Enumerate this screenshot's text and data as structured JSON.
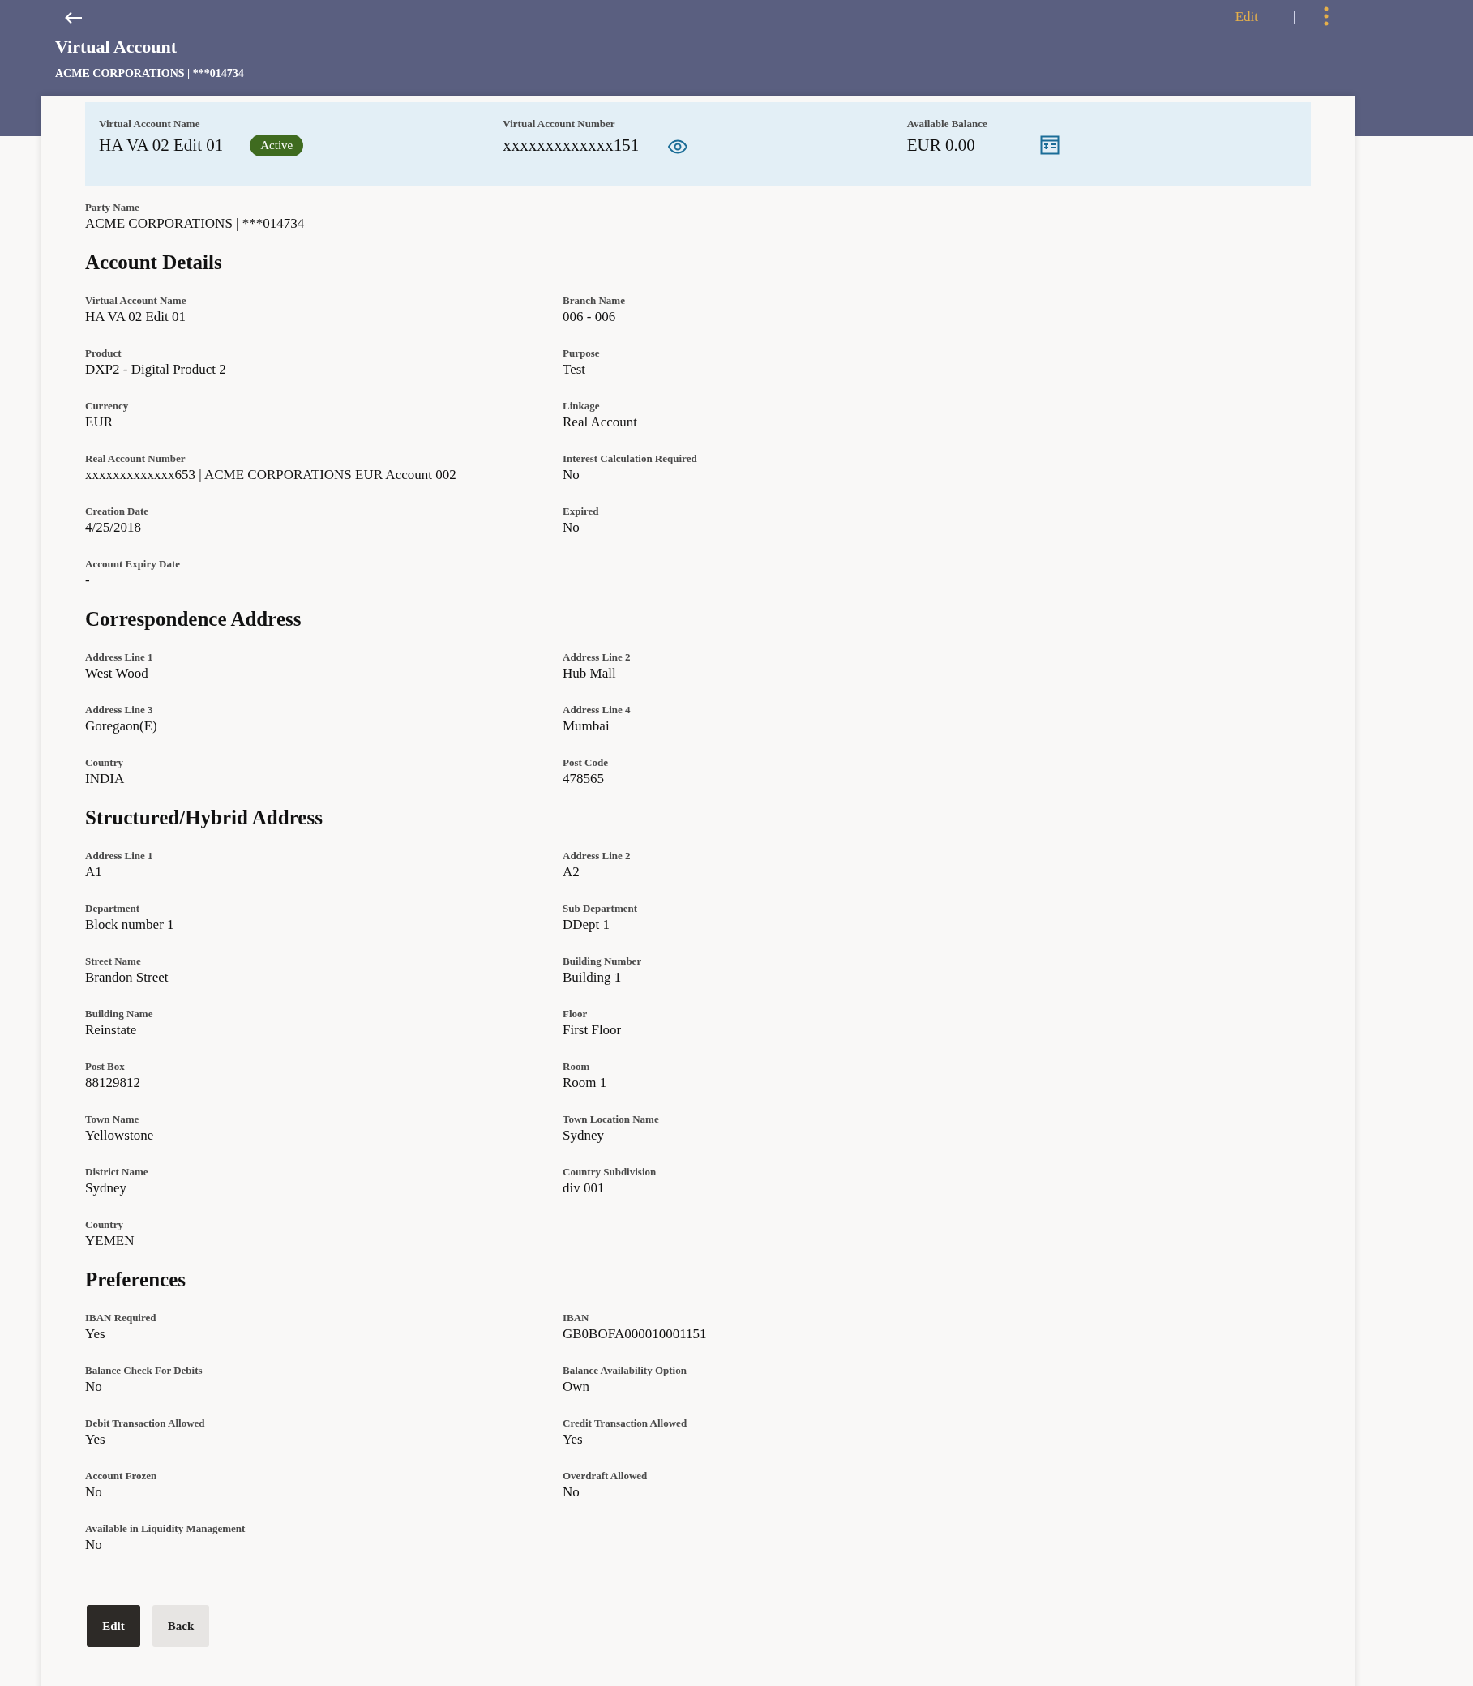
{
  "header": {
    "title": "Virtual Account",
    "subtitle": "ACME CORPORATIONS | ***014734",
    "edit_link": "Edit"
  },
  "summary": [
    {
      "label": "Virtual Account Name",
      "value": "HA VA 02 Edit 01",
      "kind": "status",
      "badge": "Active"
    },
    {
      "label": "Virtual Account Number",
      "value": "xxxxxxxxxxxxx151",
      "kind": "reveal"
    },
    {
      "label": "Available Balance",
      "value": "EUR 0.00",
      "kind": "statement"
    }
  ],
  "party": {
    "label": "Party Name",
    "value": "ACME CORPORATIONS | ***014734"
  },
  "sections": [
    {
      "title": "Account Details",
      "fields": [
        {
          "label": "Virtual Account Name",
          "value": "HA VA 02 Edit 01"
        },
        {
          "label": "Branch Name",
          "value": "006 - 006"
        },
        {
          "label": "Product",
          "value": "DXP2 - Digital Product 2"
        },
        {
          "label": "Purpose",
          "value": "Test"
        },
        {
          "label": "Currency",
          "value": "EUR"
        },
        {
          "label": "Linkage",
          "value": "Real Account"
        },
        {
          "label": "Real Account Number",
          "value": "xxxxxxxxxxxxx653 | ACME CORPORATIONS EUR Account 002"
        },
        {
          "label": "Interest Calculation Required",
          "value": "No"
        },
        {
          "label": "Creation Date",
          "value": "4/25/2018"
        },
        {
          "label": "Expired",
          "value": "No"
        },
        {
          "label": "Account Expiry Date",
          "value": "-"
        }
      ]
    },
    {
      "title": "Correspondence Address",
      "fields": [
        {
          "label": "Address Line 1",
          "value": "West Wood"
        },
        {
          "label": "Address Line 2",
          "value": "Hub Mall"
        },
        {
          "label": "Address Line 3",
          "value": "Goregaon(E)"
        },
        {
          "label": "Address Line 4",
          "value": "Mumbai"
        },
        {
          "label": "Country",
          "value": "INDIA"
        },
        {
          "label": "Post Code",
          "value": "478565"
        }
      ]
    },
    {
      "title": "Structured/Hybrid Address",
      "fields": [
        {
          "label": "Address Line 1",
          "value": "A1"
        },
        {
          "label": "Address Line 2",
          "value": "A2"
        },
        {
          "label": "Department",
          "value": "Block number 1"
        },
        {
          "label": "Sub Department",
          "value": "DDept 1"
        },
        {
          "label": "Street Name",
          "value": "Brandon Street"
        },
        {
          "label": "Building Number",
          "value": "Building 1"
        },
        {
          "label": "Building Name",
          "value": "Reinstate"
        },
        {
          "label": "Floor",
          "value": "First Floor"
        },
        {
          "label": "Post Box",
          "value": "88129812"
        },
        {
          "label": "Room",
          "value": "Room 1"
        },
        {
          "label": "Town Name",
          "value": "Yellowstone"
        },
        {
          "label": "Town Location Name",
          "value": "Sydney"
        },
        {
          "label": "District Name",
          "value": "Sydney"
        },
        {
          "label": "Country Subdivision",
          "value": "div 001"
        },
        {
          "label": "Country",
          "value": "YEMEN"
        }
      ]
    },
    {
      "title": "Preferences",
      "fields": [
        {
          "label": "IBAN Required",
          "value": "Yes"
        },
        {
          "label": "IBAN",
          "value": "GB0BOFA000010001151"
        },
        {
          "label": "Balance Check For Debits",
          "value": "No"
        },
        {
          "label": "Balance Availability Option",
          "value": "Own"
        },
        {
          "label": "Debit Transaction Allowed",
          "value": "Yes"
        },
        {
          "label": "Credit Transaction Allowed",
          "value": "Yes"
        },
        {
          "label": "Account Frozen",
          "value": "No"
        },
        {
          "label": "Overdraft Allowed",
          "value": "No"
        },
        {
          "label": "Available in Liquidity Management",
          "value": "No"
        }
      ]
    }
  ],
  "buttons": [
    {
      "label": "Edit",
      "kind": "primary"
    },
    {
      "label": "Back",
      "kind": "secondary"
    }
  ]
}
